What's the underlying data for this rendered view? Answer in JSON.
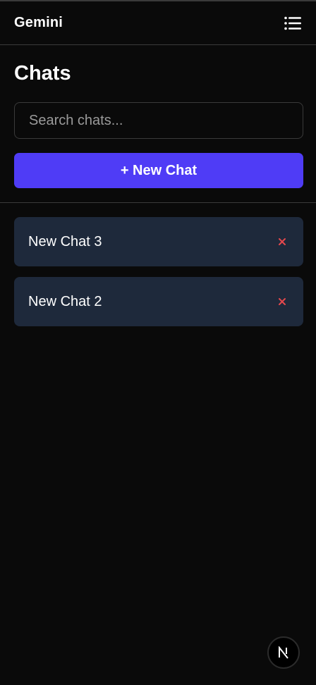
{
  "header": {
    "app_title": "Gemini",
    "menu_icon": "list-icon"
  },
  "sidebar": {
    "heading": "Chats",
    "search": {
      "placeholder": "Search chats...",
      "value": ""
    },
    "new_chat_label": "+ New Chat",
    "chats": [
      {
        "title": "New Chat 3",
        "delete_icon": "close-icon"
      },
      {
        "title": "New Chat 2",
        "delete_icon": "close-icon"
      }
    ]
  },
  "footer": {
    "badge_icon": "nextjs-logo-icon"
  },
  "colors": {
    "background": "#0a0a0a",
    "accent": "#4f3cf6",
    "chat_item_bg": "#1e293b",
    "delete": "#e5484d",
    "border": "#3b3b3b"
  }
}
